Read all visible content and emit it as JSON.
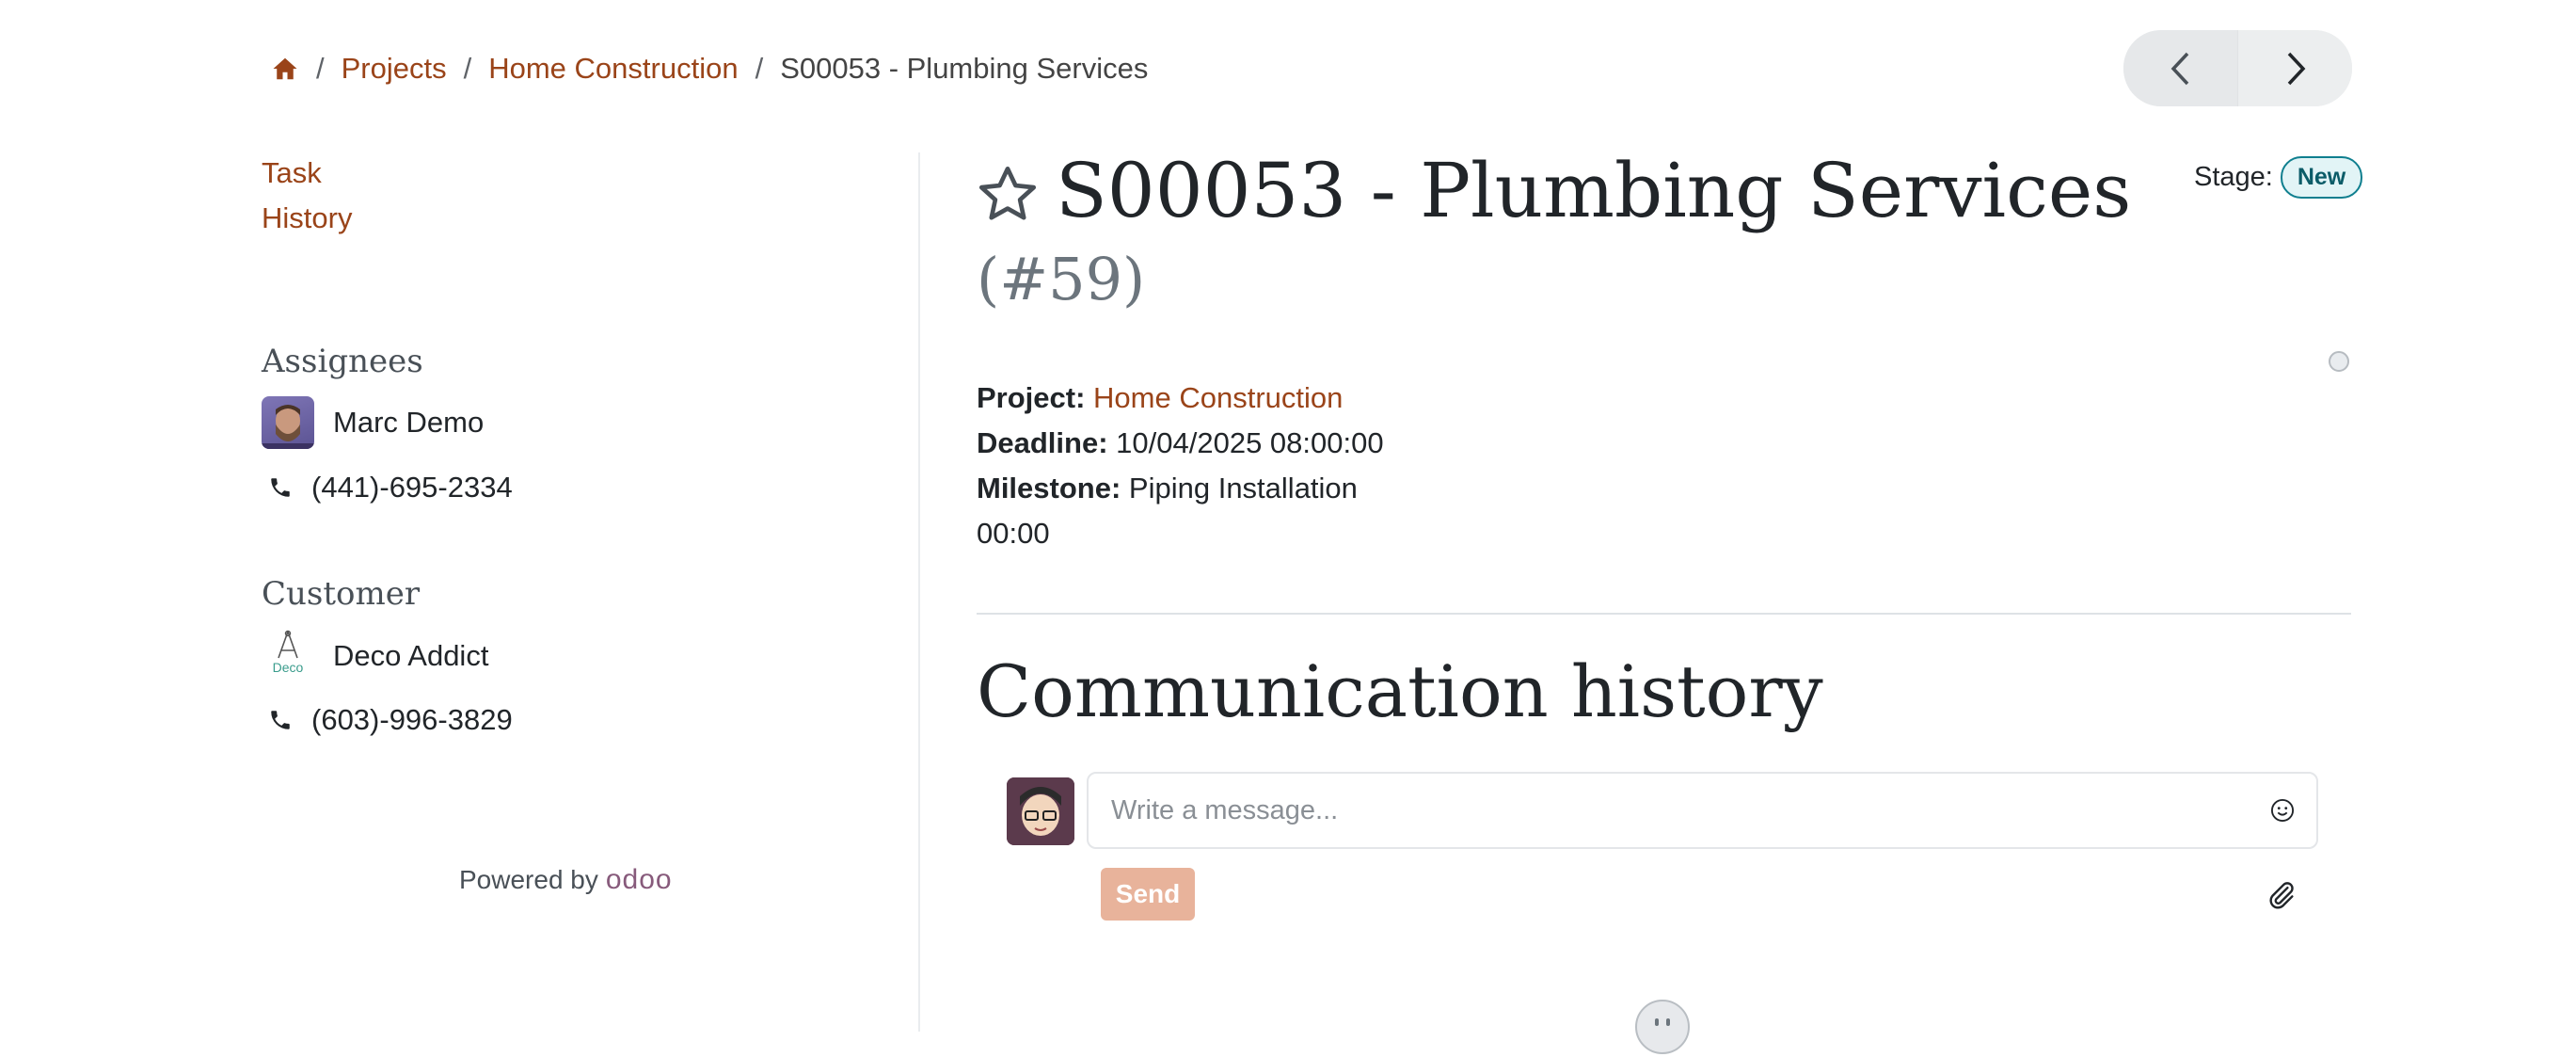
{
  "breadcrumb": {
    "home_icon": "home-icon",
    "items": [
      "Projects",
      "Home Construction"
    ],
    "separator": "/",
    "current": "S00053 - Plumbing Services"
  },
  "pager": {
    "prev_icon": "chevron-left-icon",
    "next_icon": "chevron-right-icon"
  },
  "sidebar": {
    "nav": [
      "Task",
      "History"
    ],
    "assignees_title": "Assignees",
    "assignee": {
      "name": "Marc Demo",
      "phone": "(441)-695-2334"
    },
    "customer_title": "Customer",
    "customer": {
      "name": "Deco Addict",
      "logo_text": "Deco",
      "phone": "(603)-996-3829"
    },
    "powered_by": "Powered by",
    "odoo_logo": "odoo"
  },
  "task": {
    "title": "S00053 - Plumbing Services",
    "id": "(#59)",
    "stage_label": "Stage:",
    "stage_value": "New",
    "project_label": "Project:",
    "project_value": "Home Construction",
    "deadline_label": "Deadline:",
    "deadline_value": "10/04/2025 08:00:00",
    "milestone_label": "Milestone:",
    "milestone_value": "Piping Installation",
    "milestone_extra": "00:00"
  },
  "communication": {
    "title": "Communication history",
    "placeholder": "Write a message...",
    "send_label": "Send"
  },
  "colors": {
    "link": "#9a4419",
    "send_button": "#e8b39b",
    "stage_badge": "#0f7f8f"
  }
}
